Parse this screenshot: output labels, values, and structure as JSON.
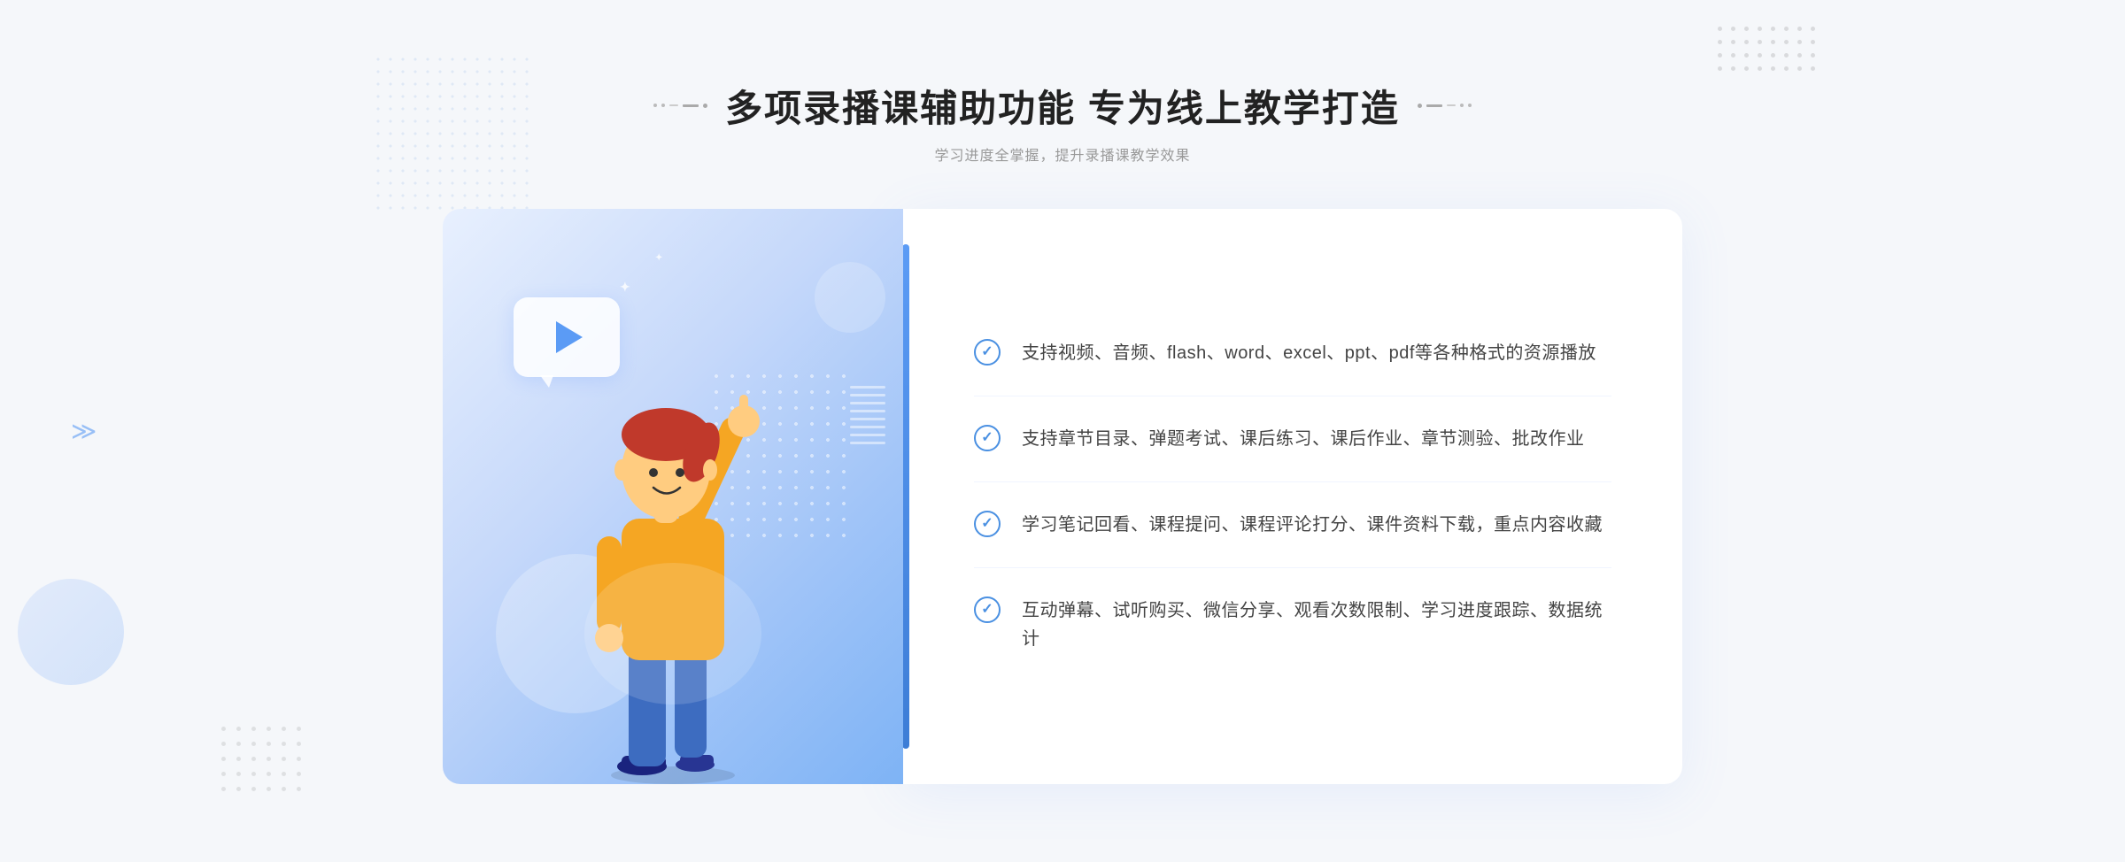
{
  "header": {
    "title": "多项录播课辅助功能 专为线上教学打造",
    "subtitle": "学习进度全掌握，提升录播课教学效果"
  },
  "features": [
    {
      "id": "feature-1",
      "text": "支持视频、音频、flash、word、excel、ppt、pdf等各种格式的资源播放"
    },
    {
      "id": "feature-2",
      "text": "支持章节目录、弹题考试、课后练习、课后作业、章节测验、批改作业"
    },
    {
      "id": "feature-3",
      "text": "学习笔记回看、课程提问、课程评论打分、课件资料下载，重点内容收藏"
    },
    {
      "id": "feature-4",
      "text": "互动弹幕、试听购买、微信分享、观看次数限制、学习进度跟踪、数据统计"
    }
  ],
  "illustration": {
    "play_button_aria": "play button",
    "person_aria": "person pointing upward"
  }
}
